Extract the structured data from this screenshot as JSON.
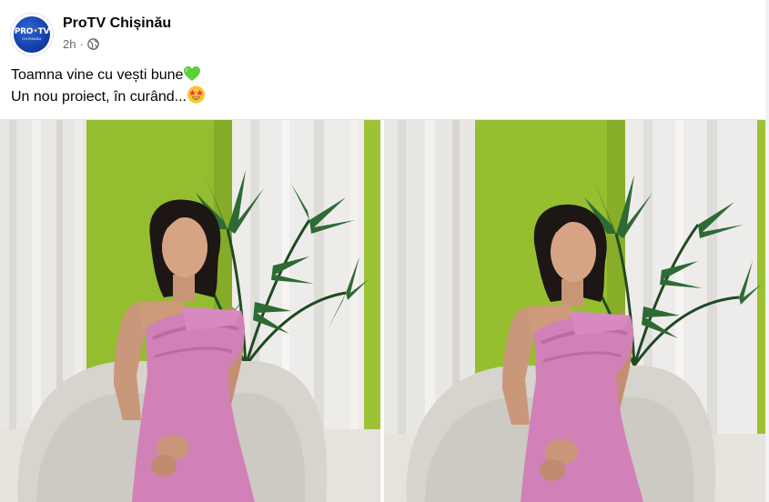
{
  "post": {
    "page_name": "ProTV Chișinău",
    "time": "2h",
    "separator": "·",
    "avatar_logo": {
      "main_left": "PRO",
      "dot": "•",
      "main_right": "TV",
      "sub": "CHIȘINĂU"
    },
    "caption_lines": [
      "Toamna vine cu vești bune",
      "Un nou proiect, în curând..."
    ],
    "icons": {
      "privacy": "globe-icon",
      "line1_emoji": "green-heart-emoji",
      "line2_emoji": "star-struck-emoji"
    }
  },
  "colors": {
    "name_text": "#050505",
    "meta_text": "#65676b",
    "brand_blue": "#1440a8",
    "wall_green": "#93bc2c",
    "dress_pink": "#d07fb6",
    "chair_grey": "#d6d2cc",
    "curtain_white": "#e8e6e3"
  },
  "photos": [
    {
      "name": "photo-left"
    },
    {
      "name": "photo-right"
    }
  ]
}
